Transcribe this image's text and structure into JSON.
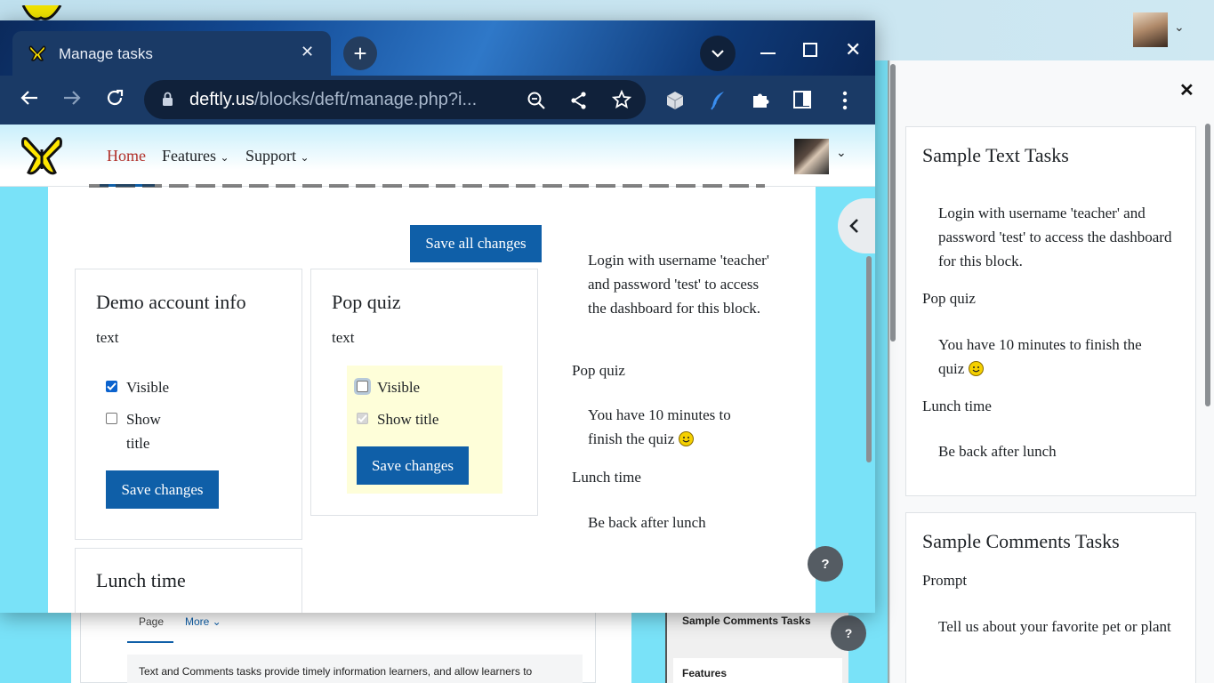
{
  "browser": {
    "tab_title": "Manage tasks",
    "url_domain": "deftly.us",
    "url_path": "/blocks/deft/manage.php?i..."
  },
  "site_nav": {
    "home": "Home",
    "features": "Features",
    "support": "Support"
  },
  "page": {
    "save_all_label": "Save all changes",
    "card_demo": {
      "title": "Demo account info",
      "type": "text",
      "visible_label": "Visible",
      "show_title_line1": "Show",
      "show_title_line2": "title",
      "save_label": "Save changes"
    },
    "card_pop": {
      "title": "Pop quiz",
      "type": "text",
      "visible_label": "Visible",
      "show_title_label": "Show title",
      "save_label": "Save changes"
    },
    "card_lunch": {
      "title": "Lunch time"
    },
    "preview": {
      "login_text": "Login with username 'teacher' and password 'test' to access the dashboard for this block.",
      "pop_title": "Pop quiz",
      "pop_text": "You have 10 minutes to finish the quiz",
      "lunch_title": "Lunch time",
      "lunch_text": "Be back after lunch"
    },
    "help_label": "?"
  },
  "drawer": {
    "text_tasks": {
      "title": "Sample Text Tasks",
      "login_text": "Login with username 'teacher' and password 'test' to access the dashboard for this block.",
      "pop_title": "Pop quiz",
      "pop_text": "You have 10 minutes to finish the quiz",
      "lunch_title": "Lunch time",
      "lunch_text": "Be back after lunch"
    },
    "comments_tasks": {
      "title": "Sample Comments Tasks",
      "prompt_title": "Prompt",
      "prompt_text": "Tell us about your favorite pet or plant"
    }
  },
  "background": {
    "tab_page": "Page",
    "tab_more": "More",
    "desc": "Text and Comments tasks provide timely information learners, and  allow learners to",
    "side_item1": "Sample Comments Tasks",
    "side_item2": "Features",
    "help_label": "?"
  }
}
